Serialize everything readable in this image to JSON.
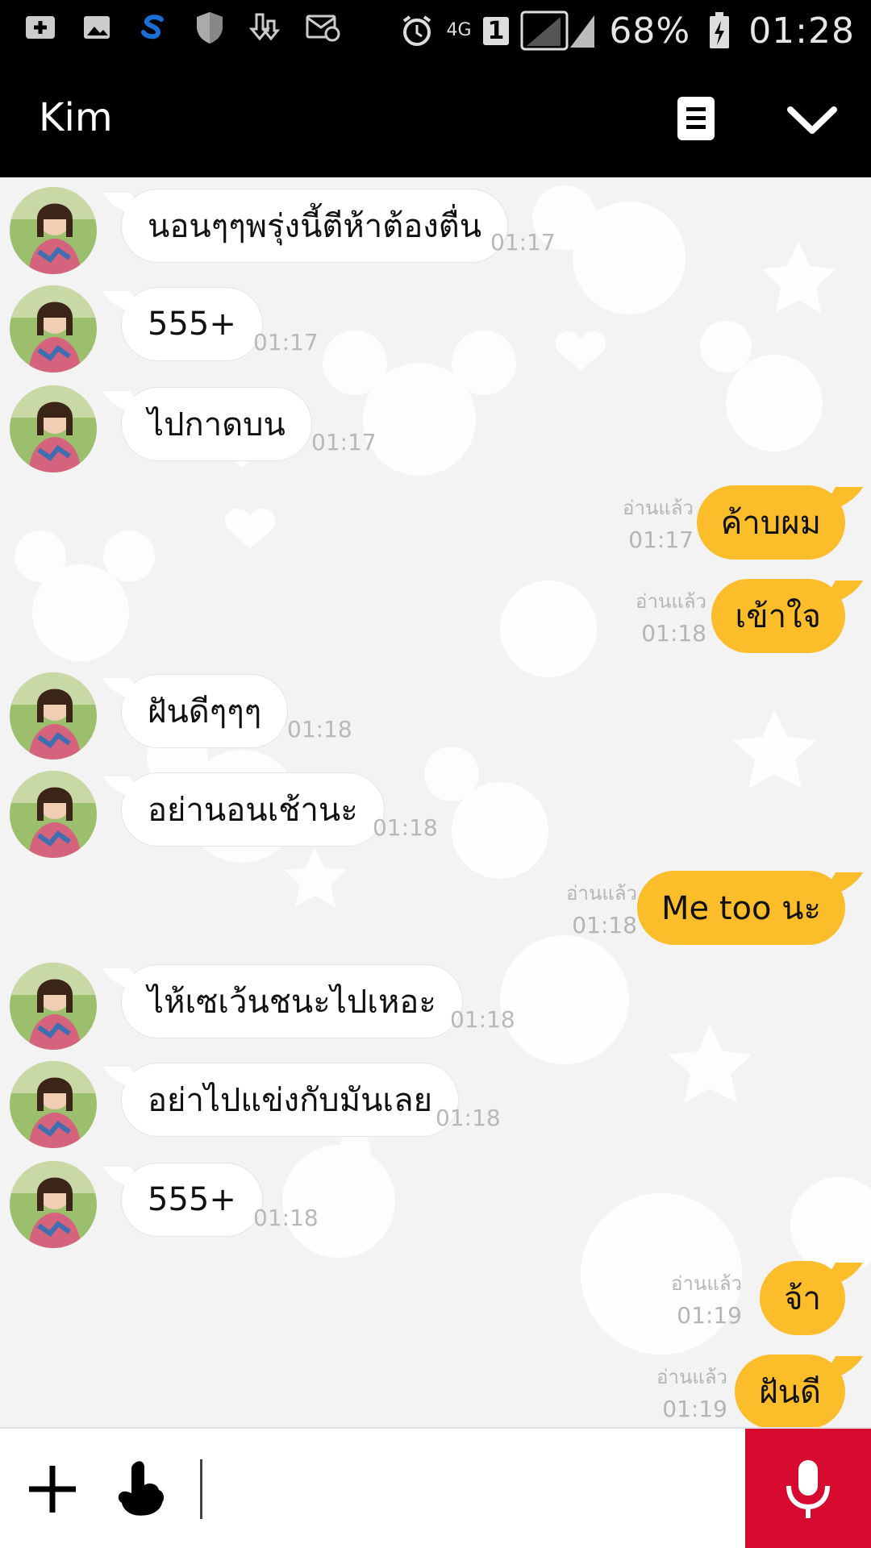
{
  "status_bar": {
    "network": "4G",
    "sim": "1",
    "battery": "68%",
    "time": "01:28",
    "icons": [
      "add-box-icon",
      "image-icon",
      "skype-icon",
      "shield-icon",
      "download-icon",
      "email-icon",
      "alarm-icon",
      "signal-icon",
      "battery-charging-icon"
    ]
  },
  "header": {
    "title": "Kim",
    "menu_icon": "menu-icon",
    "collapse_icon": "chevron-down-icon"
  },
  "messages": [
    {
      "dir": "in",
      "text": "นอนๆๆพรุ่งนี้ตีห้าต้องตื่น",
      "time": "01:17"
    },
    {
      "dir": "in",
      "text": "555+",
      "time": "01:17"
    },
    {
      "dir": "in",
      "text": "ไปกาดบน",
      "time": "01:17"
    },
    {
      "dir": "out",
      "text": "ค้าบผม",
      "read": "อ่านแล้ว",
      "time": "01:17"
    },
    {
      "dir": "out",
      "text": "เข้าใจ",
      "read": "อ่านแล้ว",
      "time": "01:18"
    },
    {
      "dir": "in",
      "text": "ฝันดีๆๆๆ",
      "time": "01:18"
    },
    {
      "dir": "in",
      "text": "อย่านอนเช้านะ",
      "time": "01:18"
    },
    {
      "dir": "out",
      "text": "Me too นะ",
      "read": "อ่านแล้ว",
      "time": "01:18"
    },
    {
      "dir": "in",
      "text": "ไห้เซเว้นชนะไปเหอะ",
      "time": "01:18"
    },
    {
      "dir": "in",
      "text": "อย่าไปแข่งกับมันเลย",
      "time": "01:18"
    },
    {
      "dir": "in",
      "text": "555+",
      "time": "01:18"
    },
    {
      "dir": "out",
      "text": "จ้า",
      "read": "อ่านแล้ว",
      "time": "01:19"
    },
    {
      "dir": "out",
      "text": "ฝันดี",
      "read": "อ่านแล้ว",
      "time": "01:19"
    }
  ],
  "input_bar": {
    "plus_icon": "plus-icon",
    "sticker_icon": "sticker-icon",
    "text_value": "",
    "mic_icon": "microphone-icon"
  },
  "colors": {
    "outgoing_bubble": "#fbbd29",
    "incoming_bubble": "#ffffff",
    "mic_button": "#d60a2f",
    "header_bg": "#000000"
  }
}
